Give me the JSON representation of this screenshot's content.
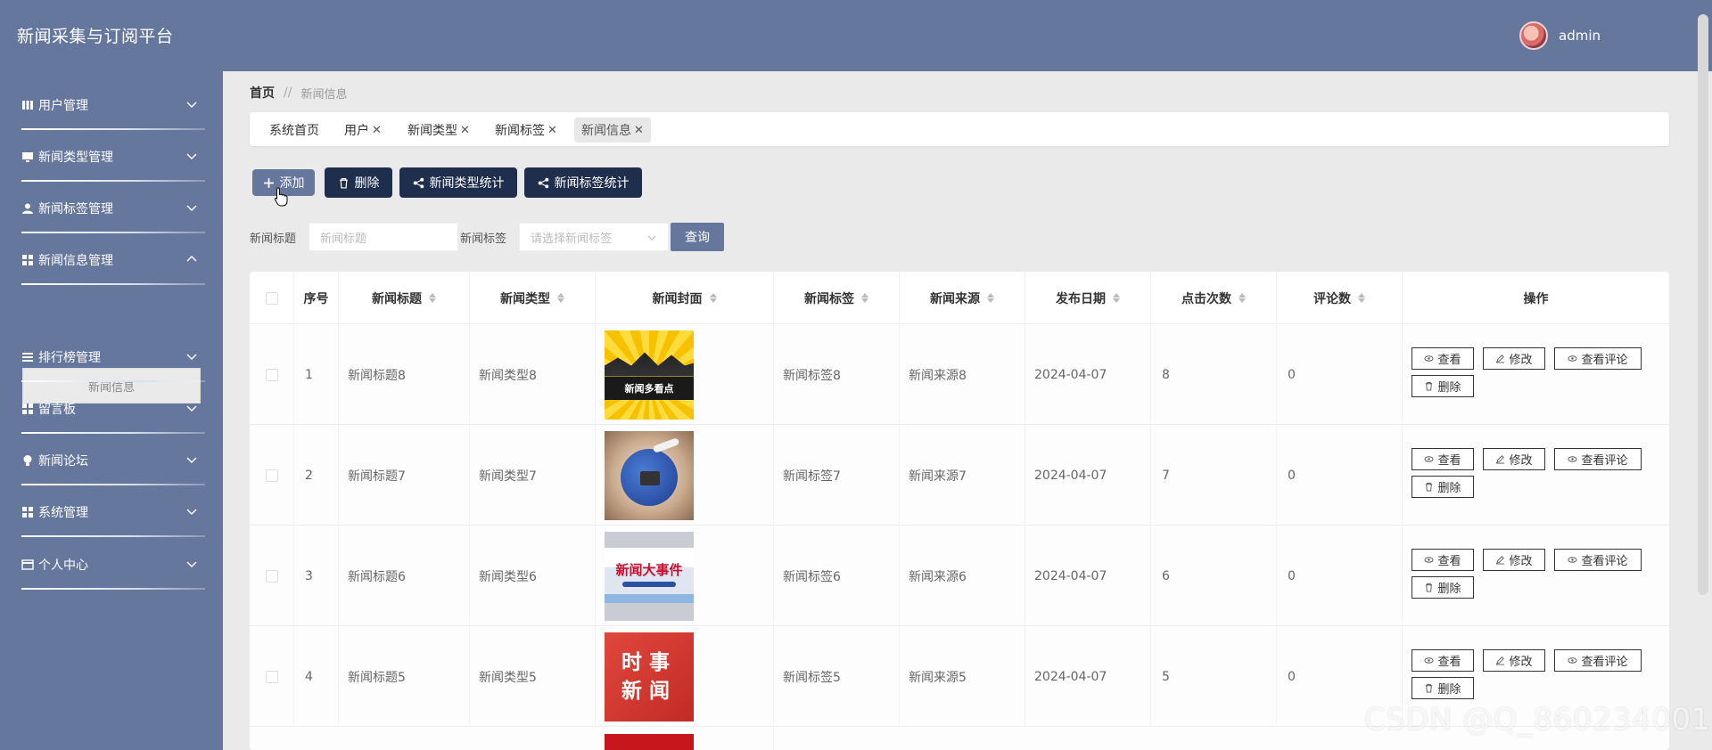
{
  "header": {
    "app_title": "新闻采集与订阅平台",
    "username": "admin"
  },
  "sidebar": {
    "items": [
      {
        "label": "用户管理",
        "icon": "bars-icon"
      },
      {
        "label": "新闻类型管理",
        "icon": "monitor-icon"
      },
      {
        "label": "新闻标签管理",
        "icon": "user-icon"
      },
      {
        "label": "新闻信息管理",
        "icon": "grid-icon",
        "expanded": true
      },
      {
        "label": "排行榜管理",
        "icon": "list-icon"
      },
      {
        "label": "留言板",
        "icon": "grid-icon"
      },
      {
        "label": "新闻论坛",
        "icon": "bulb-icon"
      },
      {
        "label": "系统管理",
        "icon": "grid-icon"
      },
      {
        "label": "个人中心",
        "icon": "card-icon"
      }
    ],
    "sub_item": "新闻信息"
  },
  "breadcrumb": {
    "home": "首页",
    "separator": "//",
    "current": "新闻信息"
  },
  "tabs": [
    {
      "label": "系统首页",
      "closable": false
    },
    {
      "label": "用户",
      "closable": true
    },
    {
      "label": "新闻类型",
      "closable": true
    },
    {
      "label": "新闻标签",
      "closable": true
    },
    {
      "label": "新闻信息",
      "closable": true,
      "active": true
    }
  ],
  "toolbar": {
    "add": "添加",
    "delete": "删除",
    "type_stats": "新闻类型统计",
    "tag_stats": "新闻标签统计"
  },
  "search": {
    "title_label": "新闻标题",
    "title_placeholder": "新闻标题",
    "tag_label": "新闻标签",
    "tag_placeholder": "请选择新闻标签",
    "query_button": "查询"
  },
  "table": {
    "headers": [
      "序号",
      "新闻标题",
      "新闻类型",
      "新闻封面",
      "新闻标签",
      "新闻来源",
      "发布日期",
      "点击次数",
      "评论数",
      "操作"
    ],
    "rows": [
      {
        "index": "1",
        "title": "新闻标题8",
        "type": "新闻类型8",
        "cover_text": "新闻多看点",
        "tag": "新闻标签8",
        "source": "新闻来源8",
        "date": "2024-04-07",
        "clicks": "8",
        "comments": "0"
      },
      {
        "index": "2",
        "title": "新闻标题7",
        "type": "新闻类型7",
        "cover_text": "",
        "tag": "新闻标签7",
        "source": "新闻来源7",
        "date": "2024-04-07",
        "clicks": "7",
        "comments": "0"
      },
      {
        "index": "3",
        "title": "新闻标题6",
        "type": "新闻类型6",
        "cover_text": "新闻大事件",
        "tag": "新闻标签6",
        "source": "新闻来源6",
        "date": "2024-04-07",
        "clicks": "6",
        "comments": "0"
      },
      {
        "index": "4",
        "title": "新闻标题5",
        "type": "新闻类型5",
        "cover_text": "时事新闻",
        "tag": "新闻标签5",
        "source": "新闻来源5",
        "date": "2024-04-07",
        "clicks": "5",
        "comments": "0"
      }
    ],
    "actions": {
      "view": "查看",
      "edit": "修改",
      "view_comments": "查看评论",
      "delete": "删除"
    }
  },
  "watermark": "CSDN @Q_860234001",
  "colors": {
    "sidebar": "#66779d",
    "dark_button": "#1f2e4d",
    "background": "#eaeaea"
  }
}
